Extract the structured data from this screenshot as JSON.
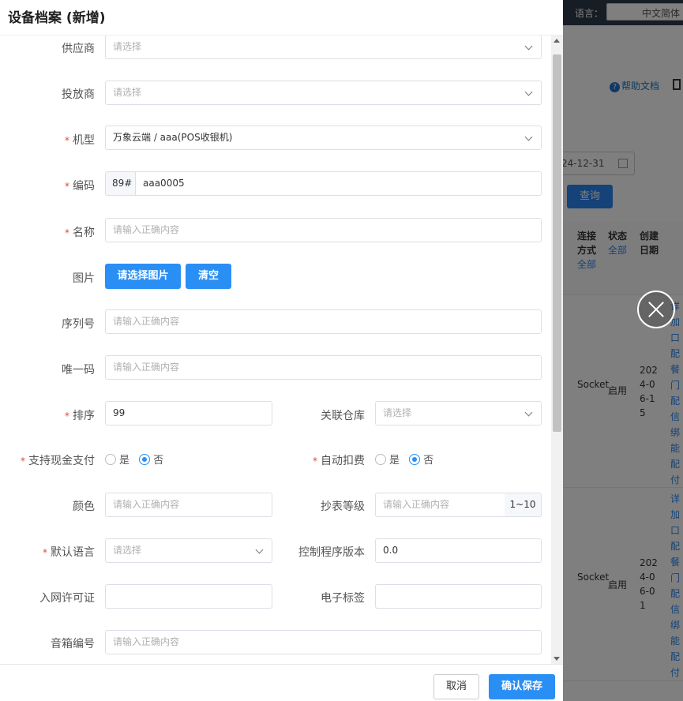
{
  "drawer": {
    "title": "设备档案 (新增)",
    "fields": {
      "supplier": {
        "label": "供应商",
        "placeholder": "请选择",
        "required": false
      },
      "distributor": {
        "label": "投放商",
        "placeholder": "请选择",
        "required": false
      },
      "model": {
        "label": "机型",
        "value": "万象云端 / aaa(POS收银机)",
        "required": true
      },
      "code": {
        "label": "编码",
        "prefix": "89#",
        "value": "aaa0005",
        "required": true
      },
      "name": {
        "label": "名称",
        "placeholder": "请输入正确内容",
        "required": true
      },
      "image": {
        "label": "图片",
        "select_button": "请选择图片",
        "clear_button": "清空"
      },
      "serial": {
        "label": "序列号",
        "placeholder": "请输入正确内容"
      },
      "unique_code": {
        "label": "唯一码",
        "placeholder": "请输入正确内容"
      },
      "sort": {
        "label": "排序",
        "value": "99",
        "required": true
      },
      "warehouse": {
        "label": "关联仓库",
        "placeholder": "请选择"
      },
      "cash_payment": {
        "label": "支持现金支付",
        "required": true,
        "yes": "是",
        "no": "否",
        "selected": "no"
      },
      "auto_deduct": {
        "label": "自动扣费",
        "required": true,
        "yes": "是",
        "no": "否",
        "selected": "no"
      },
      "color": {
        "label": "颜色",
        "placeholder": "请输入正确内容"
      },
      "meter_level": {
        "label": "抄表等级",
        "placeholder": "请输入正确内容",
        "suffix": "1~10"
      },
      "default_lang": {
        "label": "默认语言",
        "placeholder": "请选择",
        "required": true
      },
      "firmware": {
        "label": "控制程序版本",
        "value": "0.0"
      },
      "network_license": {
        "label": "入网许可证",
        "value": ""
      },
      "e_tag": {
        "label": "电子标签",
        "value": ""
      },
      "speaker": {
        "label": "音箱编号",
        "placeholder": "请输入正确内容"
      }
    },
    "footer": {
      "cancel": "取消",
      "save": "确认保存"
    },
    "required_mark": "*"
  },
  "background": {
    "language_label": "语言：",
    "language_value": "中文简体",
    "help_doc": "帮助文档",
    "date_fragment": "24-12-31",
    "query_button": "查询",
    "table": {
      "headers": {
        "connection": "连接方式",
        "connection_filter": "全部",
        "status": "状态",
        "status_filter": "全部",
        "created": "创建日期"
      },
      "rows": [
        {
          "connection": "Socket",
          "status": "启用",
          "created": "2024-06-15"
        },
        {
          "connection": "Socket",
          "status": "启用",
          "created": "2024-06-01"
        }
      ],
      "link_column_fragments": "详加口配餐门配信绑能配付复"
    }
  },
  "colors": {
    "primary": "#2a8ff5",
    "required": "#e24444",
    "overlay": "rgba(0,0,0,0.5)"
  }
}
